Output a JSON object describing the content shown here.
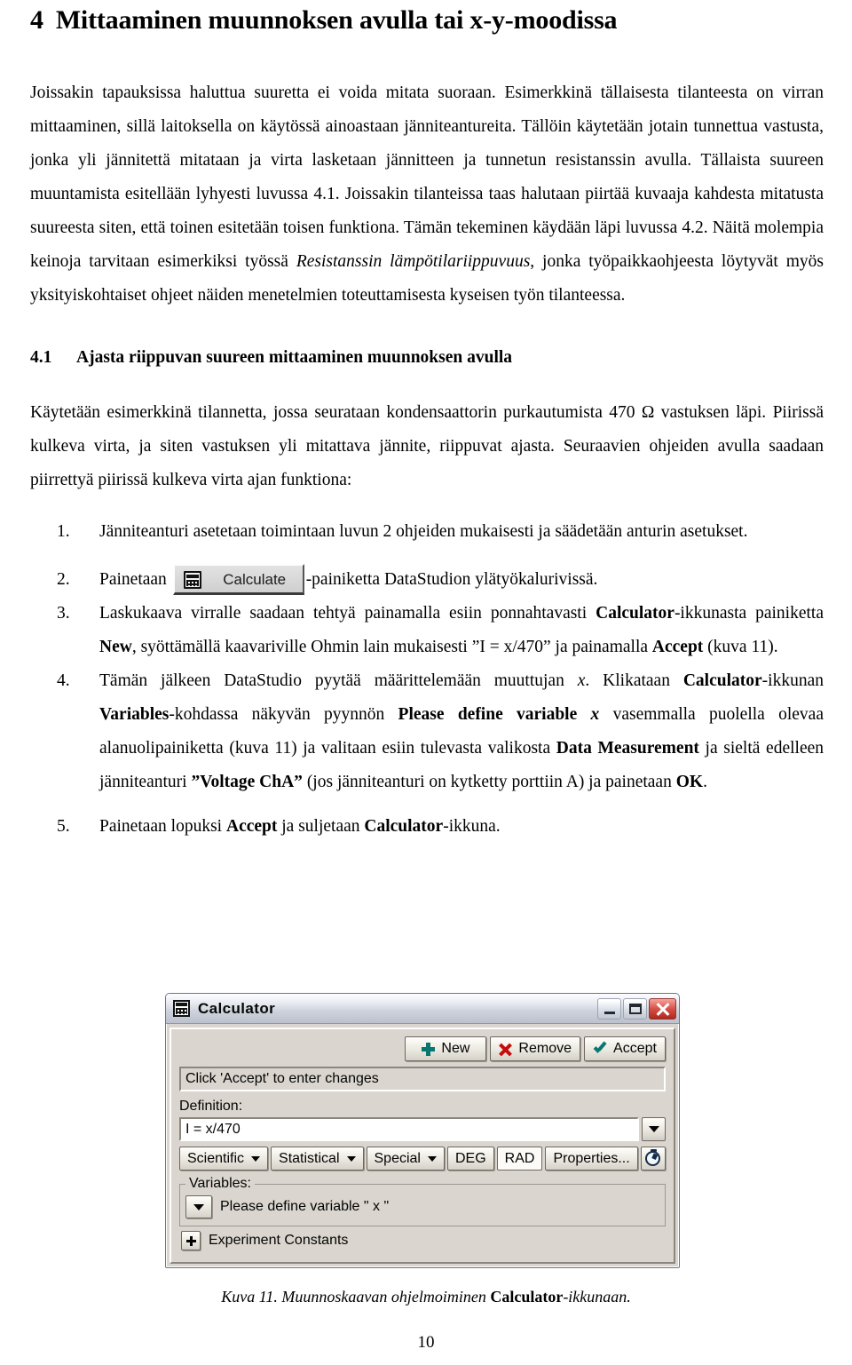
{
  "document": {
    "heading": {
      "number": "4",
      "text": "Mittaaminen muunnoksen avulla tai x-y-moodissa"
    },
    "intro_paragraph_parts": {
      "p1": "Joissakin tapauksissa haluttua suuretta ei voida mitata suoraan. Esimerkkinä tällaisesta tilanteesta on virran mittaaminen, sillä laitoksella on käytössä ainoastaan jänniteantureita. Tällöin käytetään jotain tunnettua vastusta, jonka yli jännitettä mitataan ja virta lasketaan jännitteen ja tunnetun resistanssin avulla. Tällaista suureen muuntamista esitellään lyhyesti luvussa 4.1. Joissakin tilanteissa taas halutaan piirtää kuvaaja kahdesta mitatusta suureesta siten, että toinen esitetään toisen funktiona. Tämän tekeminen käydään läpi luvussa 4.2. Näitä molempia keinoja tarvitaan esimerkiksi työssä ",
      "italic_work_title": "Resistanssin lämpötilariippuvuus",
      "p2": ", jonka työpaikkaohjeesta löytyvät myös yksityiskohtaiset ohjeet näiden menetelmien toteuttamisesta kyseisen työn tilanteessa."
    },
    "subheading": {
      "number": "4.1",
      "text": "Ajasta riippuvan suureen mittaaminen muunnoksen avulla"
    },
    "section_paragraph": "Käytetään esimerkkinä tilannetta, jossa seurataan kondensaattorin purkautumista 470 Ω vastuksen läpi. Piirissä kulkeva virta, ja siten vastuksen yli mitattava jännite, riippuvat ajasta. Seuraavien ohjeiden avulla saadaan piirrettyä piirissä kulkeva virta ajan funktiona:",
    "steps": {
      "step1": {
        "marker": "1.",
        "text": "Jänniteanturi asetetaan toimintaan luvun 2 ohjeiden mukaisesti ja säädetään anturin asetukset."
      },
      "step2": {
        "marker": "2.",
        "text_before": "Painetaan",
        "button_label": "Calculate",
        "button_icon": "calculator-icon",
        "text_after": "-painiketta DataStudion ylätyökalurivissä."
      },
      "step3": {
        "marker": "3.",
        "t1": "Laskukaava virralle saadaan tehtyä painamalla esiin ponnahtavasti ",
        "b1": "Calculator",
        "t2": "-ikkunasta painiketta ",
        "b2": "New",
        "t3": ", syöttämällä kaavariville Ohmin lain mukaisesti ”I = x/470” ja painamalla ",
        "b3": "Accept",
        "t4": " (kuva 11)."
      },
      "step4": {
        "marker": "4.",
        "t1": "Tämän jälkeen DataStudio pyytää määrittelemään muuttujan ",
        "i1": "x",
        "t2": ". Klikataan ",
        "b1": "Calculator",
        "t3": "-ikkunan ",
        "b2": "Variables",
        "t4": "-kohdassa näkyvän pyynnön ",
        "b3": "Please define variable ",
        "i2": "x",
        "t5": " vasemmalla puolella olevaa alanuolipainiketta (kuva 11) ja valitaan esiin tulevasta valikosta ",
        "b4": "Data Measurement",
        "t6": " ja sieltä edelleen jänniteanturi ",
        "b5": "”Voltage ChA”",
        "t7": " (jos jänniteanturi on kytketty porttiin A) ja painetaan ",
        "b6": "OK",
        "t8": "."
      },
      "step5": {
        "marker": "5.",
        "t1": "Painetaan lopuksi ",
        "b1": "Accept",
        "t2": " ja suljetaan ",
        "b2": "Calculator",
        "t3": "-ikkuna."
      }
    },
    "figure": {
      "caption_italic_1": "Kuva 11. Muunnoskaavan ohjelmoiminen ",
      "caption_bold": "Calculator",
      "caption_italic_2": "-ikkunaan."
    },
    "page_number": "10"
  },
  "calculator_window": {
    "title": "Calculator",
    "title_icon": "calculator-icon",
    "window_controls": {
      "minimize": "minimize-icon",
      "maximize": "maximize-icon",
      "close": "close-icon"
    },
    "buttons": {
      "new": "New",
      "remove": "Remove",
      "accept": "Accept"
    },
    "status_text": "Click 'Accept' to enter changes",
    "definition_label": "Definition:",
    "definition_value": "I = x/470",
    "menu_buttons": {
      "scientific": "Scientific",
      "statistical": "Statistical",
      "special": "Special"
    },
    "angle_modes": {
      "deg": "DEG",
      "rad": "RAD",
      "selected": "RAD"
    },
    "properties_button": "Properties...",
    "timer_icon": "stopwatch-icon",
    "variables_legend": "Variables:",
    "variable_prompt": "Please define variable \" x \"",
    "experiment_constants": "Experiment Constants",
    "colors": {
      "titlebar_top": "#f3f4f8",
      "titlebar_bottom": "#b6bcc8",
      "face": "#d4d0c8",
      "close_red": "#d9554a",
      "accent_teal": "#0a7a72",
      "remove_red": "#cc1111"
    }
  }
}
